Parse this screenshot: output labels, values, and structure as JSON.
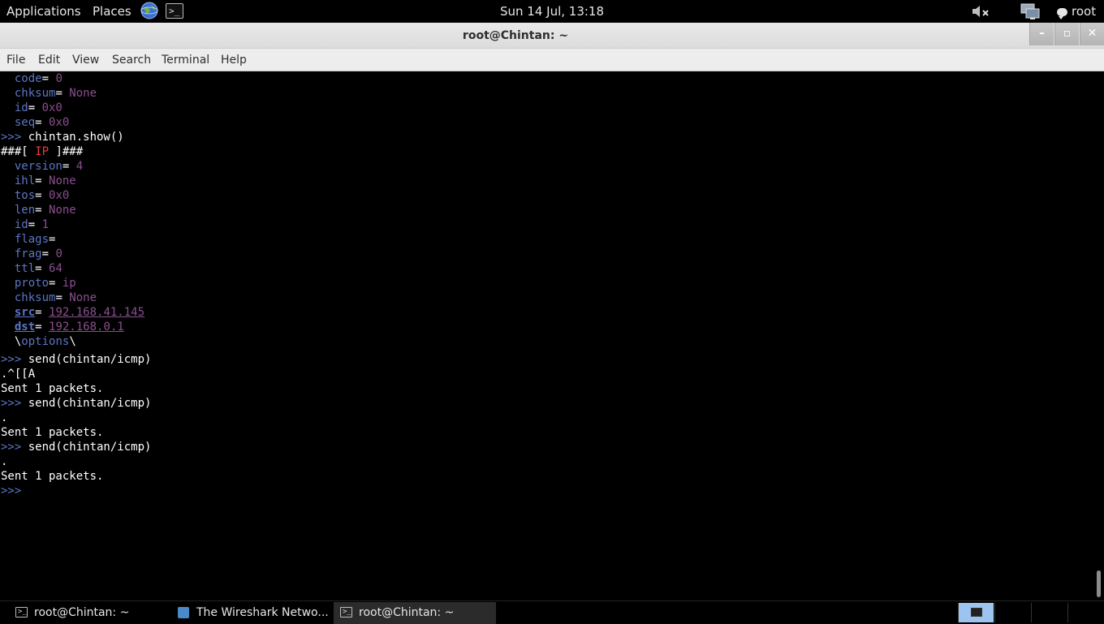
{
  "top_panel": {
    "applications": "Applications",
    "places": "Places",
    "clock": "Sun 14 Jul, 13:18",
    "user": "root"
  },
  "window": {
    "title": "root@Chintan: ~",
    "minimize": "–",
    "maximize": "▫",
    "close": "✕"
  },
  "menu": [
    "File",
    "Edit",
    "View",
    "Search",
    "Terminal",
    "Help"
  ],
  "terminal": {
    "lines": [
      {
        "k": "code",
        "v": " 0"
      },
      {
        "k": "chksum",
        "v": " None"
      },
      {
        "k": "id",
        "v": " 0x0"
      },
      {
        "k": "seq",
        "v": " 0x0"
      },
      {
        "prompt": ">>> ",
        "cmd": "chintan.show()"
      },
      {
        "pre": "###[ ",
        "layer": "IP",
        "post": " ]###"
      },
      {
        "k": "version",
        "v": " 4"
      },
      {
        "k": "ihl",
        "v": " None"
      },
      {
        "k": "tos",
        "v": " 0x0"
      },
      {
        "k": "len",
        "v": " None"
      },
      {
        "k": "id",
        "v": " 1"
      },
      {
        "k": "flags",
        "v": ""
      },
      {
        "k": "frag",
        "v": " 0"
      },
      {
        "k": "ttl",
        "v": " 64"
      },
      {
        "k": "proto",
        "v": " ip"
      },
      {
        "k": "chksum",
        "v": " None"
      },
      {
        "k": "src",
        "v": "192.168.41.145"
      },
      {
        "k": "dst",
        "v": "192.168.0.1"
      },
      {
        "opt": "options"
      },
      {
        "prompt": ">>> ",
        "cmd": "send(chintan/icmp)"
      },
      {
        "out": ".^[[A"
      },
      {
        "out": "Sent 1 packets."
      },
      {
        "prompt": ">>> ",
        "cmd": "send(chintan/icmp)"
      },
      {
        "out": "."
      },
      {
        "out": "Sent 1 packets."
      },
      {
        "prompt": ">>> ",
        "cmd": "send(chintan/icmp)"
      },
      {
        "out": "."
      },
      {
        "out": "Sent 1 packets."
      },
      {
        "prompt": ">>> ",
        "cmd": ""
      }
    ]
  },
  "taskbar": {
    "tasks": [
      {
        "label": "root@Chintan: ~",
        "icon": "terminal-icon",
        "active": false
      },
      {
        "label": "The Wireshark Netwo...",
        "icon": "wireshark-icon",
        "active": false
      },
      {
        "label": "root@Chintan: ~",
        "icon": "terminal-icon",
        "active": true
      }
    ],
    "workspaces": 4,
    "active_workspace": 1
  }
}
